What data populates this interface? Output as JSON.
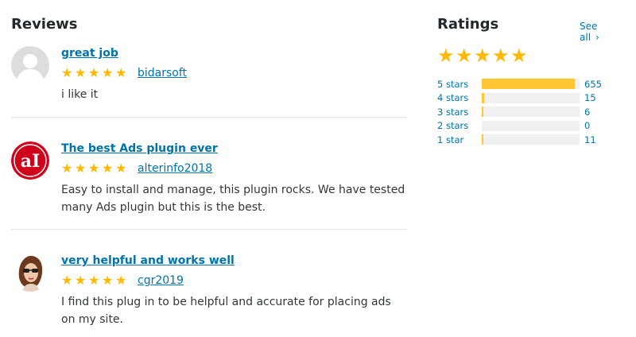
{
  "reviews": {
    "heading": "Reviews",
    "items": [
      {
        "title": "great job",
        "author": "bidarsoft",
        "content": "i like it",
        "rating": 5
      },
      {
        "title": "The best Ads plugin ever",
        "author": "alterinfo2018",
        "content": "Easy to install and manage, this plugin rocks. We have tested many Ads plugin but this is the best.",
        "rating": 5
      },
      {
        "title": "very helpful and works well",
        "author": "cgr2019",
        "content": "I find this plug in to be helpful and accurate for placing ads on my site.",
        "rating": 5
      }
    ]
  },
  "ratings": {
    "heading": "Ratings",
    "see_all": "See all",
    "overall_stars": 5,
    "star_color": "#ffb900",
    "bar_color": "#ffc733",
    "rows": [
      {
        "label": "5 stars",
        "count": "655",
        "value": 655
      },
      {
        "label": "4 stars",
        "count": "15",
        "value": 15
      },
      {
        "label": "3 stars",
        "count": "6",
        "value": 6
      },
      {
        "label": "2 stars",
        "count": "0",
        "value": 0
      },
      {
        "label": "1 star",
        "count": "11",
        "value": 11
      }
    ]
  },
  "icons": {
    "star": "star-icon",
    "chevron": "chevron-right-icon",
    "avatar_default": "default-avatar-icon"
  }
}
